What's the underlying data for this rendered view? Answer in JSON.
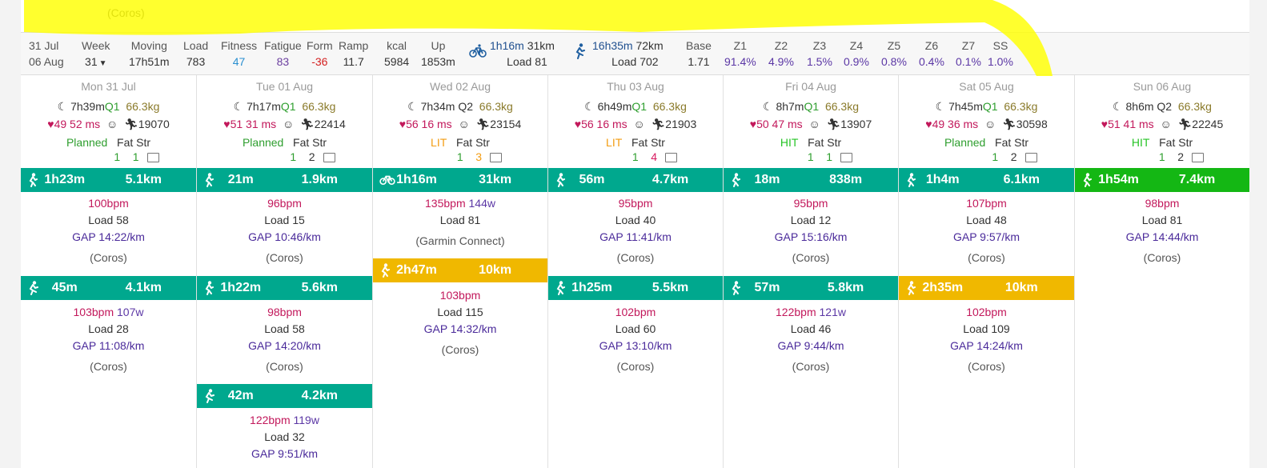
{
  "top": {
    "prev_source": "(Coros)"
  },
  "summary": {
    "date_from": "31 Jul",
    "date_to": "06 Aug",
    "week_label": "Week",
    "week_value": "31",
    "moving_label": "Moving",
    "moving_value": "17h51m",
    "load_label": "Load",
    "load_value": "783",
    "fitness_label": "Fitness",
    "fitness_value": "47",
    "fatigue_label": "Fatigue",
    "fatigue_value": "83",
    "form_label": "Form",
    "form_value": "-36",
    "ramp_label": "Ramp",
    "ramp_value": "11.7",
    "kcal_label": "kcal",
    "kcal_value": "5984",
    "up_label": "Up",
    "up_value": "1853m",
    "ride_time": "1h16m",
    "ride_dist": "31km",
    "ride_load": "Load 81",
    "run_time": "16h35m",
    "run_dist": "72km",
    "run_load": "Load 702",
    "base_label": "Base",
    "base_value": "1.71",
    "zones": [
      {
        "label": "Z1",
        "value": "91.4%"
      },
      {
        "label": "Z2",
        "value": "4.9%"
      },
      {
        "label": "Z3",
        "value": "1.5%"
      },
      {
        "label": "Z4",
        "value": "0.9%"
      },
      {
        "label": "Z5",
        "value": "0.8%"
      },
      {
        "label": "Z6",
        "value": "0.4%"
      },
      {
        "label": "Z7",
        "value": "0.1%"
      },
      {
        "label": "SS",
        "value": "1.0%"
      }
    ]
  },
  "days": [
    {
      "header": "Mon 31 Jul",
      "sleep": "7h39m",
      "quality": "Q1",
      "weight": "66.3kg",
      "rhr": "49",
      "hrv": "52 ms",
      "steps": "19070",
      "plan": "Planned",
      "fat_label": "Fat",
      "str_label": "Str",
      "fat": "1",
      "str": "1",
      "activities": [
        {
          "dur": "1h23m",
          "dist": "5.1km",
          "hr": "100bpm",
          "watts": "",
          "load": "Load 58",
          "gap": "GAP 14:22/km",
          "src": "(Coros)"
        },
        {
          "dur": "45m",
          "dist": "4.1km",
          "hr": "103bpm",
          "watts": "107w",
          "load": "Load 28",
          "gap": "GAP 11:08/km",
          "src": "(Coros)"
        }
      ]
    },
    {
      "header": "Tue 01 Aug",
      "sleep": "7h17m",
      "quality": "Q1",
      "weight": "66.3kg",
      "rhr": "51",
      "hrv": "31 ms",
      "steps": "22414",
      "plan": "Planned",
      "fat_label": "Fat",
      "str_label": "Str",
      "fat": "1",
      "str": "2",
      "activities": [
        {
          "dur": "21m",
          "dist": "1.9km",
          "hr": "96bpm",
          "watts": "",
          "load": "Load 15",
          "gap": "GAP 10:46/km",
          "src": "(Coros)"
        },
        {
          "dur": "1h22m",
          "dist": "5.6km",
          "hr": "98bpm",
          "watts": "",
          "load": "Load 58",
          "gap": "GAP 14:20/km",
          "src": "(Coros)"
        },
        {
          "dur": "42m",
          "dist": "4.2km",
          "hr": "122bpm",
          "watts": "119w",
          "load": "Load 32",
          "gap": "GAP 9:51/km",
          "src": ""
        }
      ]
    },
    {
      "header": "Wed 02 Aug",
      "sleep": "7h34m",
      "quality": "Q2",
      "weight": "66.3kg",
      "rhr": "56",
      "hrv": "16 ms",
      "steps": "23154",
      "plan": "LIT",
      "fat_label": "Fat",
      "str_label": "Str",
      "fat": "1",
      "str": "3",
      "activities": [
        {
          "dur": "1h16m",
          "dist": "31km",
          "hr": "135bpm",
          "watts": "144w",
          "load": "Load 81",
          "gap": "",
          "src": "(Garmin Connect)"
        },
        {
          "dur": "2h47m",
          "dist": "10km",
          "hr": "103bpm",
          "watts": "",
          "load": "Load 115",
          "gap": "GAP 14:32/km",
          "src": "(Coros)"
        }
      ]
    },
    {
      "header": "Thu 03 Aug",
      "sleep": "6h49m",
      "quality": "Q1",
      "weight": "66.3kg",
      "rhr": "56",
      "hrv": "16 ms",
      "steps": "21903",
      "plan": "LIT",
      "fat_label": "Fat",
      "str_label": "Str",
      "fat": "1",
      "str": "4",
      "activities": [
        {
          "dur": "56m",
          "dist": "4.7km",
          "hr": "95bpm",
          "watts": "",
          "load": "Load 40",
          "gap": "GAP 11:41/km",
          "src": "(Coros)"
        },
        {
          "dur": "1h25m",
          "dist": "5.5km",
          "hr": "102bpm",
          "watts": "",
          "load": "Load 60",
          "gap": "GAP 13:10/km",
          "src": "(Coros)"
        }
      ]
    },
    {
      "header": "Fri 04 Aug",
      "sleep": "8h7m",
      "quality": "Q1",
      "weight": "66.3kg",
      "rhr": "50",
      "hrv": "47 ms",
      "steps": "13907",
      "plan": "HIT",
      "fat_label": "Fat",
      "str_label": "Str",
      "fat": "1",
      "str": "1",
      "activities": [
        {
          "dur": "18m",
          "dist": "838m",
          "hr": "95bpm",
          "watts": "",
          "load": "Load 12",
          "gap": "GAP 15:16/km",
          "src": "(Coros)"
        },
        {
          "dur": "57m",
          "dist": "5.8km",
          "hr": "122bpm",
          "watts": "121w",
          "load": "Load 46",
          "gap": "GAP 9:44/km",
          "src": "(Coros)"
        }
      ]
    },
    {
      "header": "Sat 05 Aug",
      "sleep": "7h45m",
      "quality": "Q1",
      "weight": "66.3kg",
      "rhr": "49",
      "hrv": "36 ms",
      "steps": "30598",
      "plan": "Planned",
      "fat_label": "Fat",
      "str_label": "Str",
      "fat": "1",
      "str": "2",
      "activities": [
        {
          "dur": "1h4m",
          "dist": "6.1km",
          "hr": "107bpm",
          "watts": "",
          "load": "Load 48",
          "gap": "GAP 9:57/km",
          "src": "(Coros)"
        },
        {
          "dur": "2h35m",
          "dist": "10km",
          "hr": "102bpm",
          "watts": "",
          "load": "Load 109",
          "gap": "GAP 14:24/km",
          "src": "(Coros)"
        }
      ]
    },
    {
      "header": "Sun 06 Aug",
      "sleep": "8h6m",
      "quality": "Q2",
      "weight": "66.3kg",
      "rhr": "51",
      "hrv": "41 ms",
      "steps": "22245",
      "plan": "HIT",
      "fat_label": "Fat",
      "str_label": "Str",
      "fat": "1",
      "str": "2",
      "activities": [
        {
          "dur": "1h54m",
          "dist": "7.4km",
          "hr": "98bpm",
          "watts": "",
          "load": "Load 81",
          "gap": "GAP 14:44/km",
          "src": "(Coros)"
        }
      ]
    }
  ],
  "colors": {
    "teal": "#00a88e",
    "yellow": "#f0b800",
    "green": "#14b714",
    "highlight": "#ffff00"
  }
}
